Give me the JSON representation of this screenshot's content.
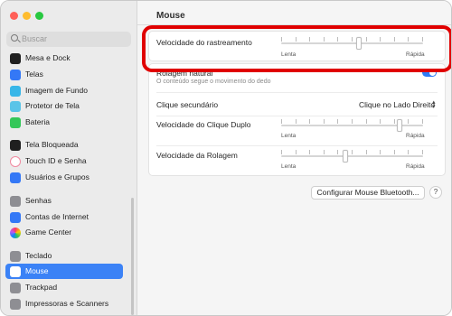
{
  "window": {
    "title": "Mouse"
  },
  "colors": {
    "accent": "#3b82f6",
    "highlight": "#e00000"
  },
  "search": {
    "placeholder": "Buscar"
  },
  "sidebar": {
    "items": [
      {
        "label": "Mesa e Dock",
        "icon": "dock-icon"
      },
      {
        "label": "Telas",
        "icon": "display-icon"
      },
      {
        "label": "Imagem de Fundo",
        "icon": "wallpaper-icon"
      },
      {
        "label": "Protetor de Tela",
        "icon": "screensaver-icon"
      },
      {
        "label": "Bateria",
        "icon": "battery-icon"
      },
      {
        "label": "Tela Bloqueada",
        "icon": "lock-screen-icon"
      },
      {
        "label": "Touch ID e Senha",
        "icon": "fingerprint-icon"
      },
      {
        "label": "Usuários e Grupos",
        "icon": "users-icon"
      },
      {
        "label": "Senhas",
        "icon": "key-icon"
      },
      {
        "label": "Contas de Internet",
        "icon": "at-icon"
      },
      {
        "label": "Game Center",
        "icon": "game-center-icon"
      },
      {
        "label": "Teclado",
        "icon": "keyboard-icon"
      },
      {
        "label": "Mouse",
        "icon": "mouse-icon",
        "selected": true
      },
      {
        "label": "Trackpad",
        "icon": "trackpad-icon"
      },
      {
        "label": "Impressoras e Scanners",
        "icon": "printer-icon"
      }
    ]
  },
  "settings": {
    "tracking_speed": {
      "label": "Velocidade do rastreamento",
      "min_label": "Lenta",
      "max_label": "Rápida",
      "value": 0.55
    },
    "natural_scroll": {
      "label": "Rolagem natural",
      "description": "O conteúdo segue o movimento do dedo",
      "on": true
    },
    "secondary_click": {
      "label": "Clique secundário",
      "value": "Clique no Lado Direito"
    },
    "double_click_speed": {
      "label": "Velocidade do Clique Duplo",
      "min_label": "Lenta",
      "max_label": "Rápida",
      "value": 0.85
    },
    "scroll_speed": {
      "label": "Velocidade da Rolagem",
      "min_label": "Lenta",
      "max_label": "Rápida",
      "value": 0.45
    }
  },
  "buttons": {
    "bluetooth": "Configurar Mouse Bluetooth...",
    "help": "?"
  }
}
